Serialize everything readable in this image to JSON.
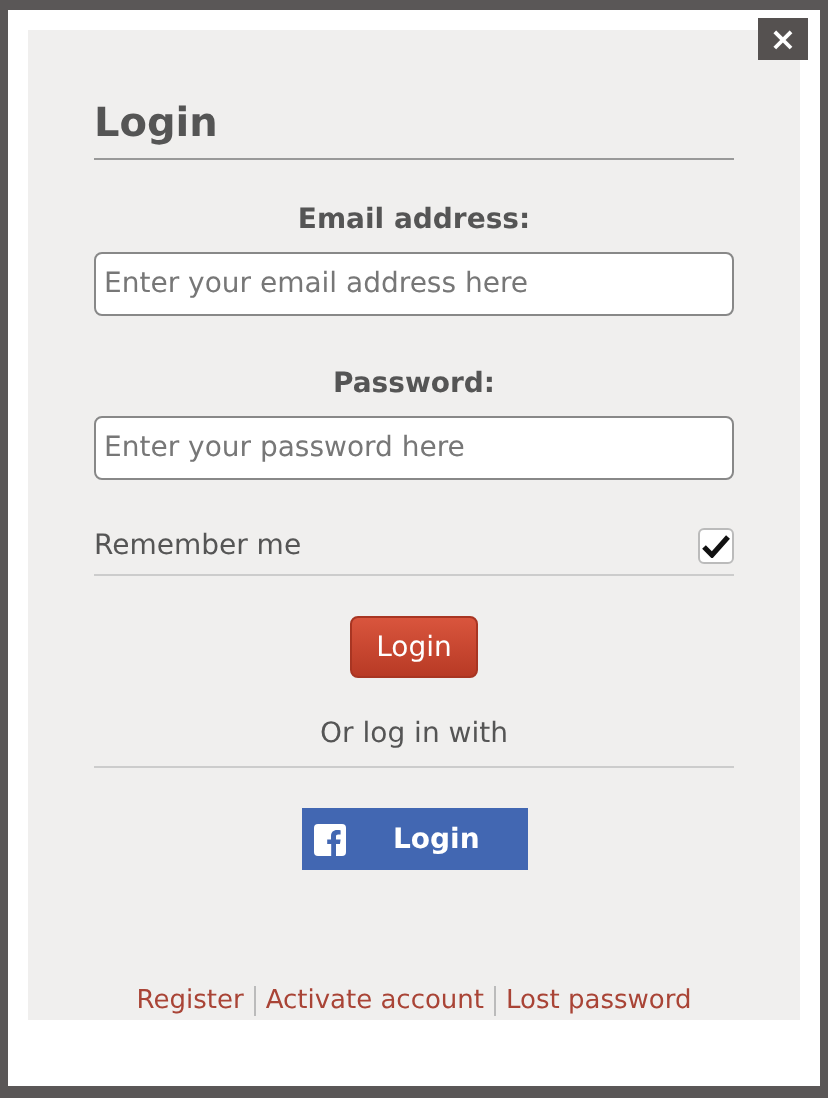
{
  "close_button": "×",
  "title": "Login",
  "fields": [
    {
      "label": "Email address:",
      "placeholder": "Enter your email address here"
    },
    {
      "label": "Password:",
      "placeholder": "Enter your password here"
    }
  ],
  "remember": {
    "label": "Remember me",
    "checked": true
  },
  "login_button": "Login",
  "divider_text": "Or log in with",
  "facebook_button": "Login",
  "links": [
    "Register",
    "Activate account",
    "Lost password"
  ]
}
